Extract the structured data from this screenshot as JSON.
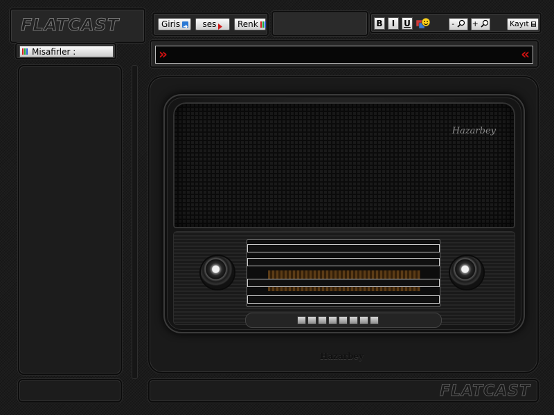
{
  "logo": {
    "text": "FLATCAST"
  },
  "footer_logo": {
    "text": "FLATCAST"
  },
  "toolbar": {
    "login_label": "Giris",
    "sound_label": "ses",
    "color_label": "Renk",
    "bold_label": "B",
    "italic_label": "I",
    "underline_label": "U",
    "zoom_out_label": "-",
    "zoom_in_label": "+",
    "save_label": "Kayıt"
  },
  "guests": {
    "label": "Misafirler :"
  },
  "ticker": {
    "left_arrows": "»",
    "right_arrows": "«"
  },
  "radio": {
    "brand_top": "Hazarbey",
    "brand_bottom": "Hazarbey"
  },
  "colors": {
    "accent_red": "#cc1111",
    "panel": "#222222",
    "background": "#1b1b1b"
  },
  "icons": [
    "login-arrow-icon",
    "sound-arrow-icon",
    "color-bars-icon",
    "smiley-icon",
    "zoom-out-icon",
    "zoom-in-icon",
    "save-disk-icon"
  ]
}
